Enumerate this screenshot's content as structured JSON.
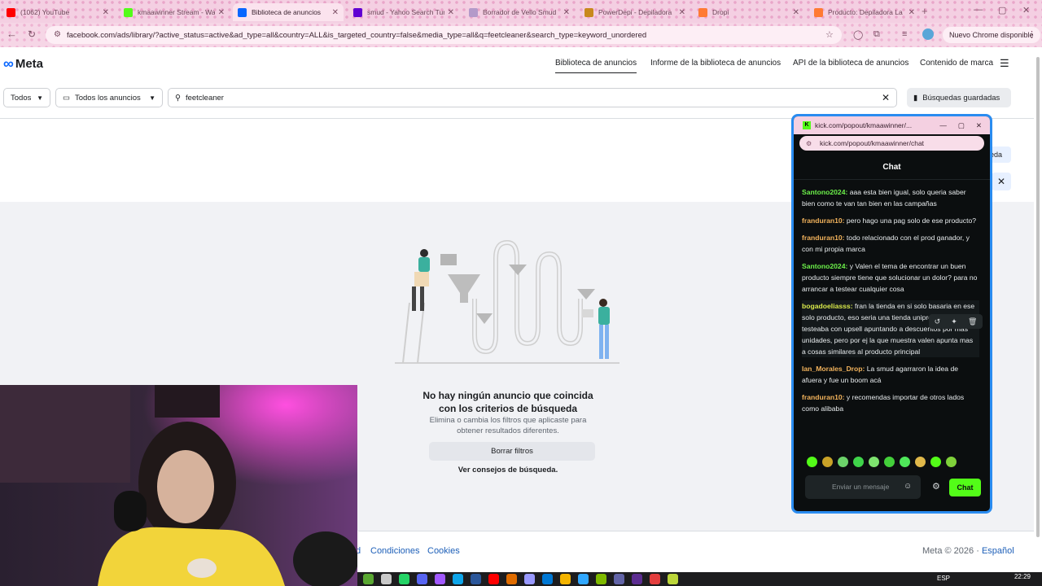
{
  "browser": {
    "tabs": [
      {
        "title": "(1062) YouTube",
        "icon": "youtube-icon",
        "color": "#ff0000"
      },
      {
        "title": "kmaawinner Stream - Wat",
        "icon": "kick-icon",
        "color": "#53fc18"
      },
      {
        "title": "Biblioteca de anuncios",
        "icon": "meta-icon",
        "color": "#0866ff"
      },
      {
        "title": "smud - Yahoo Search Tur",
        "icon": "yahoo-icon",
        "color": "#6001d2"
      },
      {
        "title": "Borrador de Vello Smud",
        "icon": "shop-icon",
        "color": "#b49ac9"
      },
      {
        "title": "PowerDepi - Depiladora",
        "icon": "shop-icon",
        "color": "#c8891d"
      },
      {
        "title": "Dropi",
        "icon": "dropi-icon",
        "color": "#ff7a33"
      },
      {
        "title": "Producto: Depiladora La",
        "icon": "product-icon",
        "color": "#ff7a33"
      }
    ],
    "active_tab": 2,
    "url": "facebook.com/ads/library/?active_status=active&ad_type=all&country=ALL&is_targeted_country=false&media_type=all&q=feetcleaner&search_type=keyword_unordered",
    "update_label": "Nuevo Chrome disponible"
  },
  "meta": {
    "logo": "Meta",
    "nav": [
      "Biblioteca de anuncios",
      "Informe de la biblioteca de anuncios",
      "API de la biblioteca de anuncios",
      "Contenido de marca"
    ],
    "filters": {
      "country": "Todos",
      "ad_type": "Todos los anuncios",
      "search_value": "feetcleaner",
      "saved_searches": "Búsquedas guardadas"
    },
    "empty_state": {
      "title": "No hay ningún anuncio que coincida con los criterios de búsqueda",
      "description": "Elimina o cambia los filtros que aplicaste para obtener resultados diferentes.",
      "clear_button": "Borrar filtros",
      "tips_link": "Ver consejos de búsqueda."
    },
    "behind_partial_label": "eda",
    "footer": {
      "partial": "d",
      "terms": "Condiciones",
      "cookies": "Cookies",
      "copyright": "Meta © 2026",
      "language": "Español"
    }
  },
  "kick_popout": {
    "title": "kick.com/popout/kmaawinner/...",
    "url": "kick.com/popout/kmaawinner/chat",
    "header": "Chat",
    "messages": [
      {
        "user": "Santono2024:",
        "text": " aaa esta bien igual, solo queria saber bien como te van tan bien en las campañas",
        "color": "#6cf04a"
      },
      {
        "user": "franduran10:",
        "text": " pero hago una pag solo de ese producto?",
        "color": "#f2b35c"
      },
      {
        "user": "franduran10:",
        "text": " todo relacionado con el prod ganador, y con mi propia marca",
        "color": "#f2b35c"
      },
      {
        "user": "Santono2024:",
        "text": " y Valen el tema de encontrar un buen producto siempre tiene que solucionar un dolor? para no arrancar a testear cualquier cosa",
        "color": "#6cf04a"
      },
      {
        "user": "bogadoeliasss:",
        "text": " fran la tienda en si solo basaria en ese solo producto, eso seria una tienda uniproducto, yo testeaba con upsell apuntando a descuentos por mas unidades, pero por ej la que muestra valen apunta mas a cosas similares al producto principal",
        "color": "#d8e84a"
      },
      {
        "user": "Ian_Morales_Drop:",
        "text": " La smud agarraron la idea de afuera y fue un boom acá",
        "color": "#f2b35c"
      },
      {
        "user": "franduran10:",
        "text": " y recomendas importar de otros lados como alibaba",
        "color": "#f2b35c"
      }
    ],
    "highlighted_message": 4,
    "input_placeholder": "Enviar un mensaje",
    "send_label": "Chat",
    "emote_colors": [
      "#53fc18",
      "#c9a227",
      "#6cd36a",
      "#3fd44a",
      "#7ee36f",
      "#43cf3a",
      "#4fe85a",
      "#e0b84a",
      "#53fc18",
      "#7fd13a"
    ]
  },
  "taskbar": {
    "lang": "ESP",
    "time": "22:29",
    "app_colors": [
      "#5aa832",
      "#c9c9c9",
      "#25d366",
      "#5865f2",
      "#a259ff",
      "#0ea5e9",
      "#2b579a",
      "#ff0000",
      "#e06c00",
      "#9999ff",
      "#0078d4",
      "#f4b400",
      "#31a8ff",
      "#7fba00",
      "#6264a7",
      "#5c2d91",
      "#e33e3e",
      "#bcd63a"
    ]
  }
}
